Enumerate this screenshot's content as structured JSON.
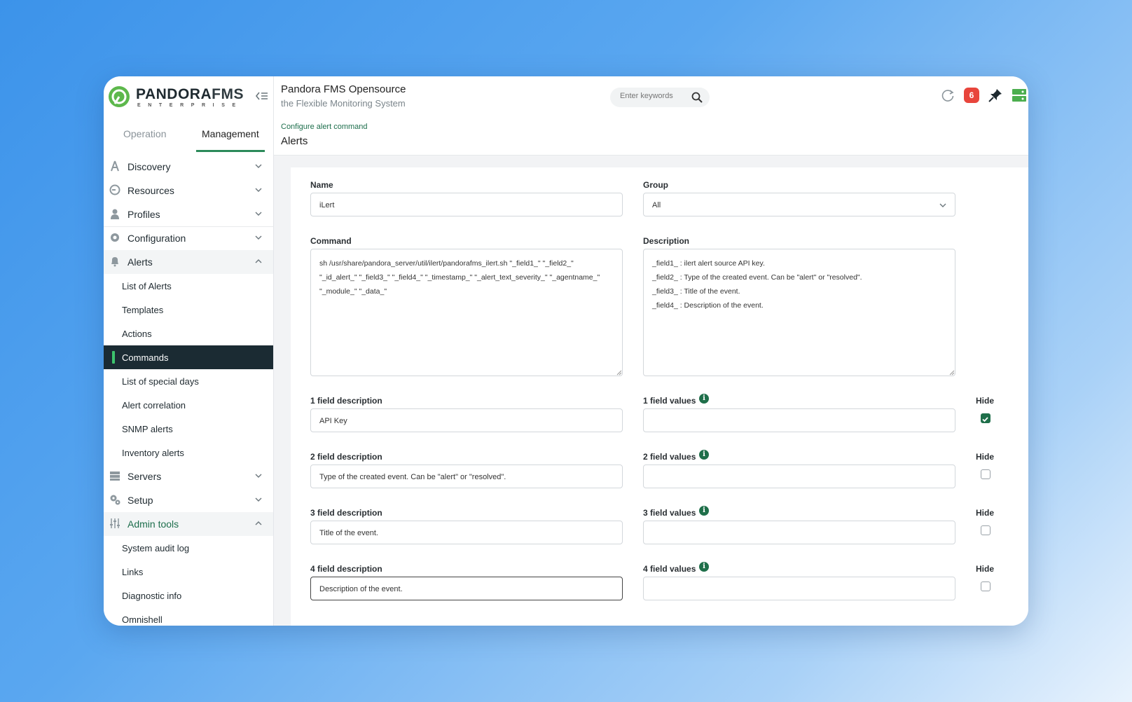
{
  "brand": {
    "name_a": "PANDORA",
    "name_b": "FMS",
    "subtitle": "ENTERPRISE"
  },
  "sidebar": {
    "tabs": [
      {
        "label": "Operation"
      },
      {
        "label": "Management"
      }
    ],
    "menu": [
      {
        "label": "Discovery"
      },
      {
        "label": "Resources"
      },
      {
        "label": "Profiles"
      },
      {
        "label": "Configuration"
      },
      {
        "label": "Alerts"
      },
      {
        "label": "Servers"
      },
      {
        "label": "Setup"
      },
      {
        "label": "Admin tools"
      }
    ],
    "alerts_sub": [
      {
        "label": "List of Alerts"
      },
      {
        "label": "Templates"
      },
      {
        "label": "Actions"
      },
      {
        "label": "Commands"
      },
      {
        "label": "List of special days"
      },
      {
        "label": "Alert correlation"
      },
      {
        "label": "SNMP alerts"
      },
      {
        "label": "Inventory alerts"
      }
    ],
    "admin_sub": [
      {
        "label": "System audit log"
      },
      {
        "label": "Links"
      },
      {
        "label": "Diagnostic info"
      },
      {
        "label": "Omnishell"
      }
    ]
  },
  "header": {
    "title": "Pandora FMS Opensource",
    "subtitle": "the Flexible Monitoring System",
    "search_placeholder": "Enter keywords",
    "notification_count": "6",
    "breadcrumb": "Configure alert command",
    "page_title": "Alerts"
  },
  "form": {
    "name_label": "Name",
    "name_value": "iLert",
    "group_label": "Group",
    "group_value": "All",
    "command_label": "Command",
    "command_value": "sh /usr/share/pandora_server/util/ilert/pandorafms_ilert.sh \"_field1_\" \"_field2_\"\n\"_id_alert_\" \"_field3_\" \"_field4_\" \"_timestamp_\" \"_alert_text_severity_\" \"_agentname_\"\n\"_module_\" \"_data_\"",
    "description_label": "Description",
    "description_value": "_field1_ : ilert alert source API key.\n_field2_ : Type of the created event. Can be \"alert\" or \"resolved\".\n_field3_ : Title of the event.\n_field4_ : Description of the event.",
    "fields": [
      {
        "desc_label": "1 field description",
        "desc_value": "API Key",
        "values_label": "1 field values",
        "hide_label": "Hide",
        "hidden": true
      },
      {
        "desc_label": "2 field description",
        "desc_value": "Type of the created event. Can be \"alert\" or \"resolved\".",
        "values_label": "2 field values",
        "hide_label": "Hide",
        "hidden": false
      },
      {
        "desc_label": "3 field description",
        "desc_value": "Title of the event.",
        "values_label": "3 field values",
        "hide_label": "Hide",
        "hidden": false
      },
      {
        "desc_label": "4 field description",
        "desc_value": "Description of the event.",
        "values_label": "4 field values",
        "hide_label": "Hide",
        "hidden": false
      }
    ]
  },
  "colors": {
    "accent": "#1f6f4a",
    "active_menu_bg": "#1b2b33",
    "badge": "#e8453c"
  }
}
